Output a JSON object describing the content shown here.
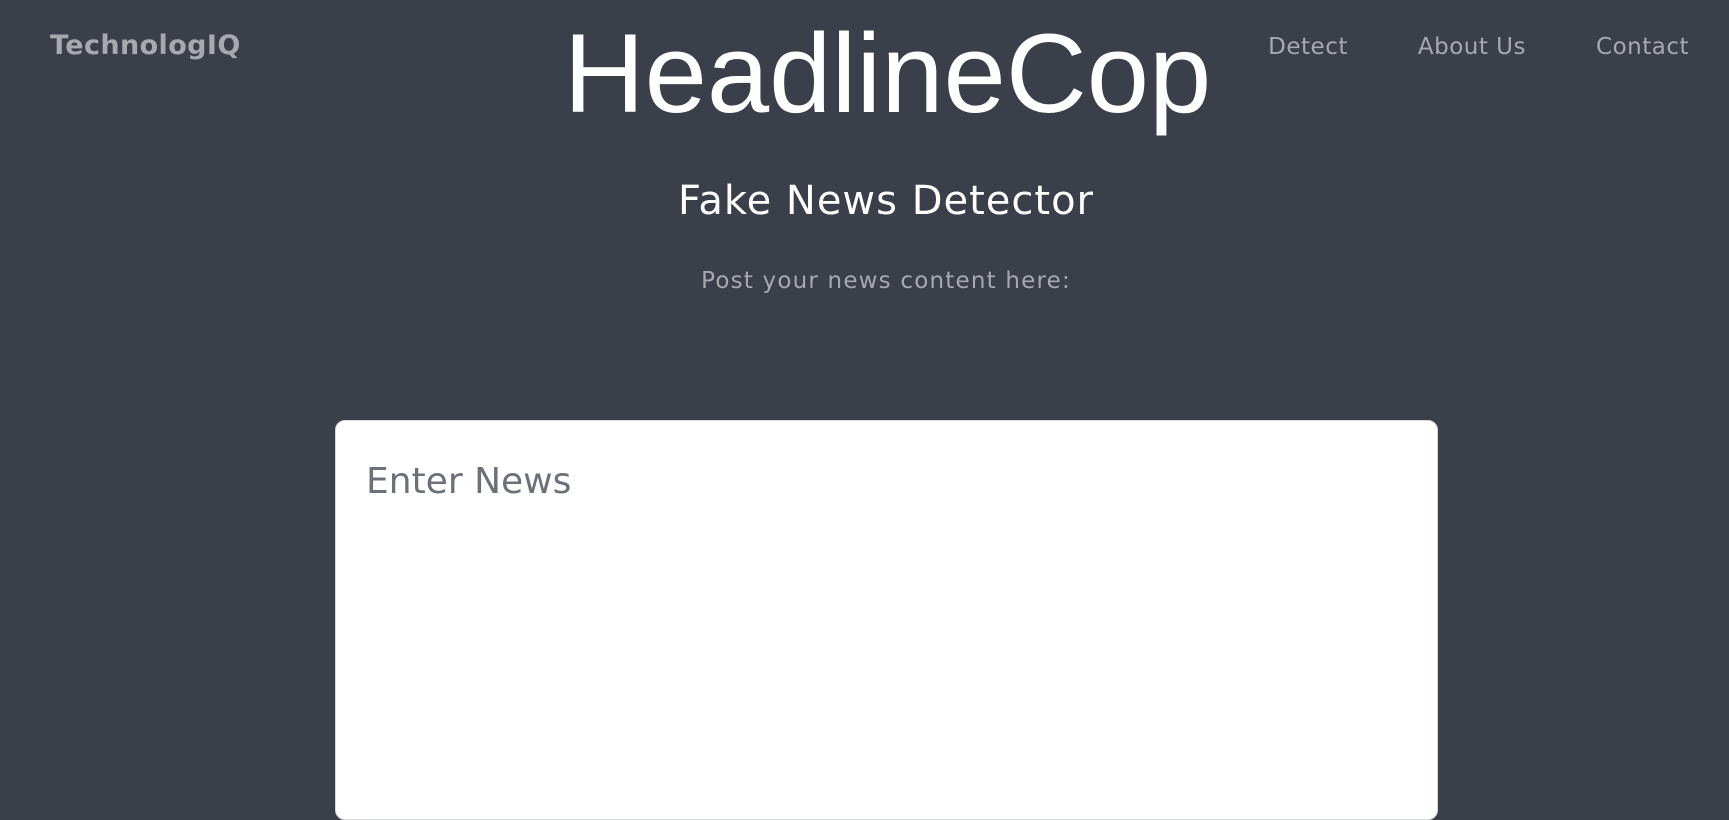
{
  "header": {
    "brand": "TechnologIQ",
    "nav": [
      {
        "label": "Detect"
      },
      {
        "label": "About Us"
      },
      {
        "label": "Contact"
      }
    ]
  },
  "hero": {
    "title": "HeadlineCop",
    "subtitle": "Fake News Detector",
    "prompt": "Post your news content here:"
  },
  "form": {
    "news_placeholder": "Enter News",
    "news_value": ""
  },
  "colors": {
    "background": "#3b3f4a",
    "muted_text": "#a7a9ae",
    "title_text": "#ffffff",
    "input_background": "#ffffff"
  }
}
